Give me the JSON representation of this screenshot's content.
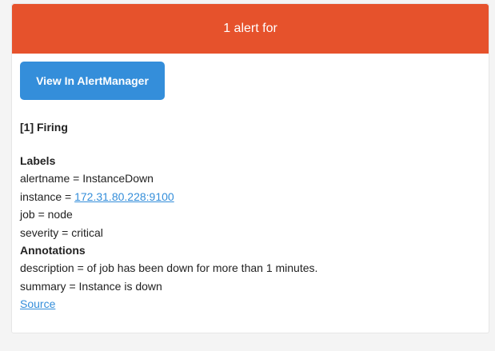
{
  "header": {
    "title": "1 alert for",
    "color": "#e6522c"
  },
  "button": {
    "label": "View In AlertManager",
    "color": "#348eda"
  },
  "alert": {
    "status": "[1] Firing",
    "labels_title": "Labels",
    "labels": {
      "alertname": {
        "key": "alertname = ",
        "value": "InstanceDown"
      },
      "instance": {
        "key": "instance = ",
        "value": "172.31.80.228:9100"
      },
      "job": {
        "key": "job = ",
        "value": "node"
      },
      "severity": {
        "key": "severity = ",
        "value": "critical"
      }
    },
    "annotations_title": "Annotations",
    "annotations": {
      "description": {
        "key": "description = ",
        "value": "of job has been down for more than 1 minutes."
      },
      "summary": {
        "key": "summary = ",
        "value": "Instance is down"
      }
    },
    "source_label": "Source"
  }
}
